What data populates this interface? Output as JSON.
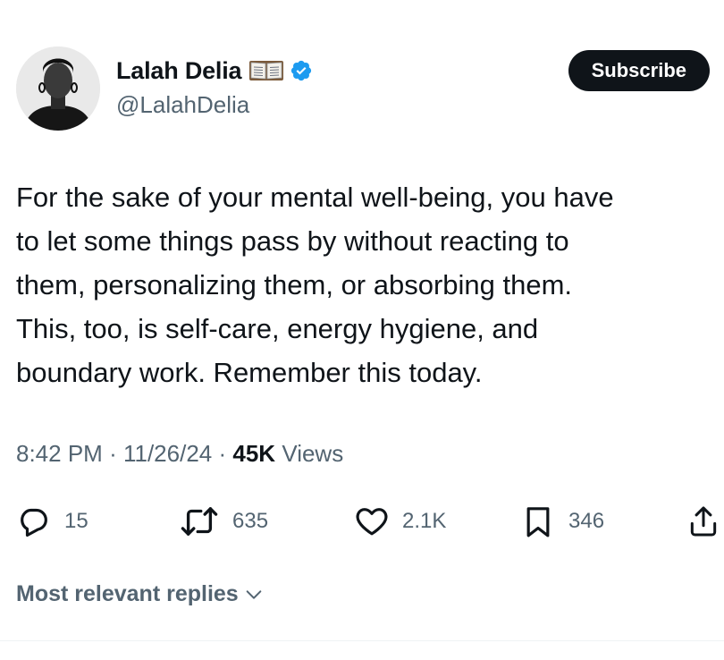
{
  "author": {
    "display_name": "Lalah Delia",
    "handle": "@LalahDelia",
    "badge_icons": [
      "open-book-emoji",
      "verified-badge-icon"
    ],
    "verified_color": "#1d9bf0"
  },
  "subscribe_label": "Subscribe",
  "tweet": {
    "lines": [
      "For the sake of your mental well-being, you have",
      "to let some things pass by without reacting to",
      "them, personalizing them, or absorbing them.",
      "This, too, is self-care, energy hygiene, and",
      "boundary work. Remember this today."
    ]
  },
  "meta": {
    "time": "8:42 PM",
    "separator": "·",
    "date": "11/26/24",
    "views_count": "45K",
    "views_label": "Views"
  },
  "actions": {
    "replies": "15",
    "reposts": "635",
    "likes": "2.1K",
    "bookmarks": "346",
    "icons": [
      "reply-icon",
      "repost-icon",
      "like-icon",
      "bookmark-icon",
      "share-icon"
    ]
  },
  "replies_sort_label": "Most relevant replies"
}
